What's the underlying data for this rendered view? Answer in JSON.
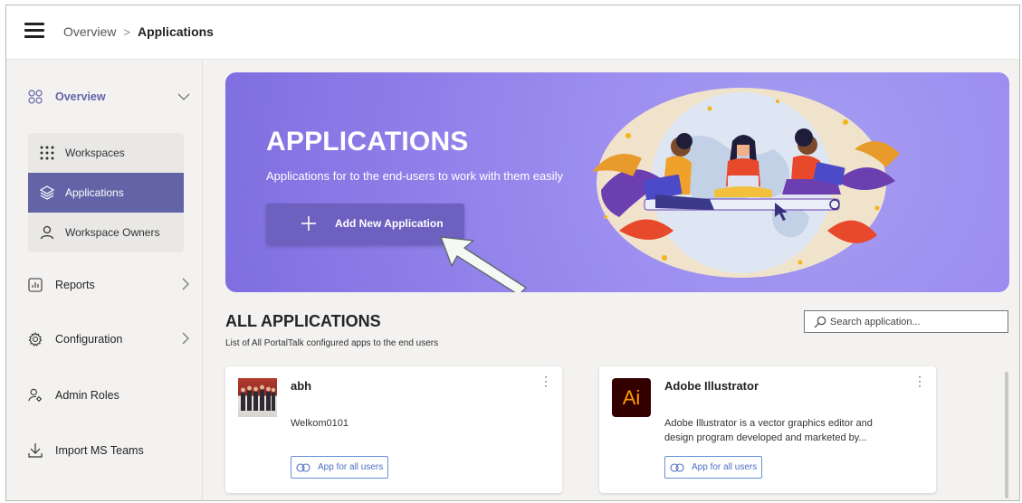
{
  "breadcrumb": {
    "parent": "Overview",
    "separator": ">",
    "current": "Applications"
  },
  "sidebar": {
    "overview": {
      "label": "Overview",
      "icon": "grid-icon"
    },
    "sub_items": [
      {
        "label": "Workspaces",
        "icon": "dots-grid-icon",
        "active": false
      },
      {
        "label": "Applications",
        "icon": "layers-icon",
        "active": true
      },
      {
        "label": "Workspace Owners",
        "icon": "person-icon",
        "active": false
      }
    ],
    "items": [
      {
        "label": "Reports",
        "icon": "chart-icon",
        "has_chevron": true
      },
      {
        "label": "Configuration",
        "icon": "gear-icon",
        "has_chevron": true
      },
      {
        "label": "Admin Roles",
        "icon": "admin-person-icon",
        "has_chevron": false
      },
      {
        "label": "Import MS Teams",
        "icon": "download-icon",
        "has_chevron": false
      }
    ]
  },
  "banner": {
    "title": "APPLICATIONS",
    "subtitle": "Applications for to the end-users to work with them easily",
    "button_label": "Add New Application"
  },
  "section": {
    "title": "ALL APPLICATIONS",
    "subtitle": "List of All PortalTalk configured apps to the end users",
    "search_placeholder": "Search application..."
  },
  "cards": [
    {
      "name": "abh",
      "description": "Welkom0101",
      "badge": "App for all users",
      "icon": "team-photo-thumbnail"
    },
    {
      "name": "Adobe Illustrator",
      "description": "Adobe Illustrator is a vector graphics editor and design program developed and marketed by...",
      "badge": "App for all users",
      "icon": "adobe-illustrator-icon",
      "icon_text": "Ai"
    }
  ],
  "colors": {
    "accent": "#6264a7",
    "banner": "#9d8ef0",
    "button": "#6d60bf",
    "badge": "#4d6ec5",
    "ai_bg": "#330000",
    "ai_fg": "#ff9a00"
  }
}
